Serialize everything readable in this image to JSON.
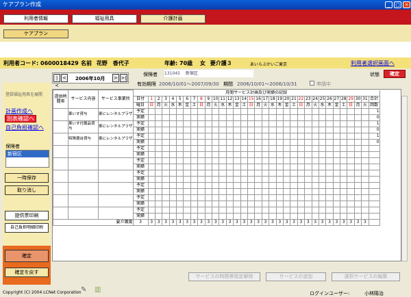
{
  "window": {
    "title": "ケアプラン作成"
  },
  "tabs": [
    {
      "label": "利用者情報"
    },
    {
      "label": "福祉用具"
    },
    {
      "label": "介護計画"
    }
  ],
  "subtab": {
    "label": "ケアプラン"
  },
  "patient": {
    "code_label": "利用者コード:",
    "code": "0600018429",
    "name_label": "名前",
    "name": "花野　香代子",
    "age_label": "年齢:",
    "age": "70歳",
    "gender": "女",
    "care_level": "要介護３",
    "office": "あいらぶかいご東京",
    "select_link": "利用者選択画面へ"
  },
  "month_nav": {
    "prev2": "|<",
    "prev": "<",
    "label": "2006年10月",
    "next": ">",
    "next2": ">|"
  },
  "insurer": {
    "label": "保険者",
    "number": "131045",
    "city": "新宿区",
    "valid_label": "有効期限",
    "valid": "2006/10/01～2007/09/30",
    "period_label": "期間",
    "period": "2006/10/01～2006/10/31",
    "apply_label": "申請中",
    "status_label": "状態",
    "status_button": "確定"
  },
  "sidebar": {
    "expand": "登録福祉用具を展開",
    "links": [
      "計画作成へ",
      "別表確認へ",
      "自己負担確認へ"
    ],
    "insurer_label": "保険者",
    "insurer_value": "新宿区",
    "buttons": [
      "一時保存",
      "取り消し",
      "提供票印刷",
      "自己負担明細印刷",
      "確定",
      "確定を戻す"
    ]
  },
  "grid": {
    "title": "月間サービス計画及び実績の記録",
    "col_time": "提供時間帯",
    "col_service": "サービス内容",
    "col_office": "サービス事業所",
    "row_date": "日付",
    "row_dow": "曜日",
    "total": "合計",
    "total2": "回数",
    "plan": "予定",
    "actual": "実績",
    "dow": [
      "日",
      "月",
      "火",
      "水",
      "木",
      "金",
      "土",
      "日",
      "月",
      "火",
      "水",
      "木",
      "金",
      "土",
      "日",
      "月",
      "火",
      "水",
      "木",
      "金",
      "土",
      "日",
      "月",
      "火",
      "水",
      "木",
      "金",
      "土",
      "日",
      "月",
      "火"
    ],
    "services": [
      {
        "name": "車いす貸与",
        "office": "楽にレンタルプラザ",
        "plan_total": "1",
        "actual_total": "0"
      },
      {
        "name": "車いす付属品貸与",
        "office": "楽にレンタルプラザ",
        "plan_total": "1",
        "actual_total": "0"
      },
      {
        "name": "特殊寝台貸与",
        "office": "楽にレンタルプラザ",
        "plan_total": "1",
        "actual_total": "0"
      }
    ],
    "care_level_row_label": "要介護度",
    "care_level_value": "3"
  },
  "footer_buttons": [
    "サービスの時間帯指定解除",
    "サービスの追加",
    "選択サービスの編集"
  ],
  "status": {
    "copyright": "Copyright (C) 2004 LCNet Corporation",
    "login_label": "ログインユーザー:",
    "login_user": "小林陽治"
  }
}
